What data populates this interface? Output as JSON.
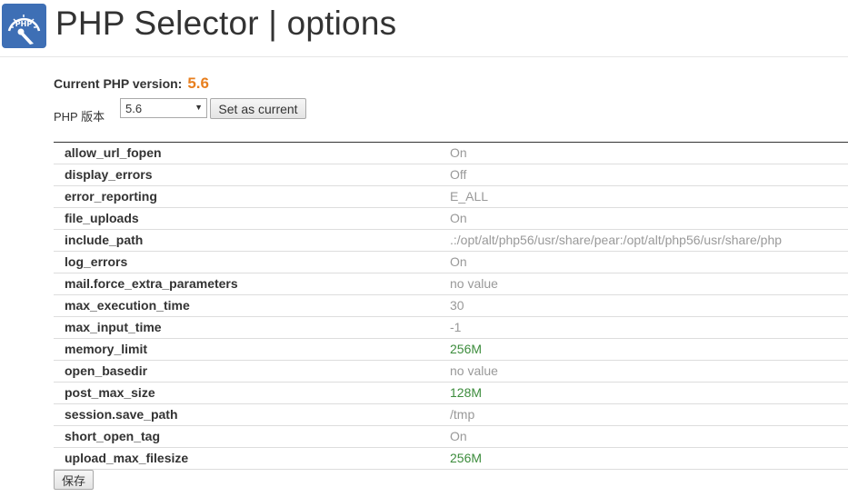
{
  "header": {
    "logo_text": "PHP",
    "title": "PHP Selector | options"
  },
  "current_version": {
    "label": "Current PHP version:",
    "value": "5.6",
    "value_color": "#e87f1e"
  },
  "selector": {
    "label": "PHP 版本",
    "selected": "5.6",
    "set_button": "Set as current"
  },
  "options": [
    {
      "name": "allow_url_fopen",
      "value": "On",
      "changed": false
    },
    {
      "name": "display_errors",
      "value": "Off",
      "changed": false
    },
    {
      "name": "error_reporting",
      "value": "E_ALL",
      "changed": false
    },
    {
      "name": "file_uploads",
      "value": "On",
      "changed": false
    },
    {
      "name": "include_path",
      "value": ".:/opt/alt/php56/usr/share/pear:/opt/alt/php56/usr/share/php",
      "changed": false
    },
    {
      "name": "log_errors",
      "value": "On",
      "changed": false
    },
    {
      "name": "mail.force_extra_parameters",
      "value": "no value",
      "changed": false
    },
    {
      "name": "max_execution_time",
      "value": "30",
      "changed": false
    },
    {
      "name": "max_input_time",
      "value": "-1",
      "changed": false
    },
    {
      "name": "memory_limit",
      "value": "256M",
      "changed": true
    },
    {
      "name": "open_basedir",
      "value": "no value",
      "changed": false
    },
    {
      "name": "post_max_size",
      "value": "128M",
      "changed": true
    },
    {
      "name": "session.save_path",
      "value": "/tmp",
      "changed": false
    },
    {
      "name": "short_open_tag",
      "value": "On",
      "changed": false
    },
    {
      "name": "upload_max_filesize",
      "value": "256M",
      "changed": true
    }
  ],
  "save_button": "保存",
  "colors": {
    "default_value": "#999999",
    "changed_value": "#3c8c3c",
    "logo_bg": "#3e6fb5"
  }
}
